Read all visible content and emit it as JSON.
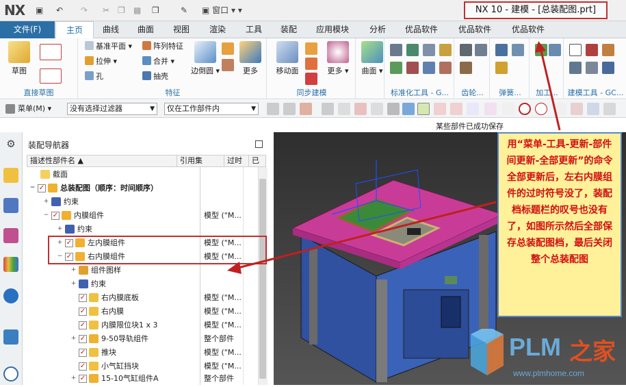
{
  "title_bar": {
    "logo": "NX",
    "window_title": "NX 10 - 建模 - [总装配图.prt]",
    "window_menu": "窗口"
  },
  "tabs": {
    "file": "文件(F)",
    "items": [
      "主页",
      "曲线",
      "曲面",
      "视图",
      "渲染",
      "工具",
      "装配",
      "应用模块",
      "分析",
      "优品软件",
      "优品软件",
      "优品软件"
    ],
    "active": "主页"
  },
  "ribbon": {
    "sketch_group": {
      "label": "直接草图",
      "big_label": "草图"
    },
    "feature_group": {
      "label": "特征",
      "items": [
        "基准平面",
        "拉伸",
        "孔",
        "阵列特征",
        "合并",
        "抽壳"
      ],
      "edge_blend": "边倒圆",
      "more": "更多"
    },
    "sync_group": {
      "label": "同步建模",
      "move_face": "移动面",
      "more": "更多"
    },
    "surface": {
      "label": "曲面"
    },
    "standard_tools": {
      "label": "标准化工具 - G..."
    },
    "gear": {
      "label": "齿轮..."
    },
    "spring": {
      "label": "弹簧..."
    },
    "machining": {
      "label": "加工..."
    },
    "modeling_tools": {
      "label": "建模工具 - GC..."
    }
  },
  "filter_bar": {
    "menu": "菜单(M)",
    "selection_filter": "没有选择过滤器",
    "scope": "仅在工作部件内"
  },
  "status": "某些部件已成功保存",
  "navigator": {
    "title": "装配导航器",
    "columns": [
      "描述性部件名",
      "引用集",
      "过时",
      "已"
    ],
    "rows": [
      {
        "label": "截面",
        "ref": ""
      },
      {
        "label": "总装配图（顺序：时间顺序）",
        "ref": ""
      },
      {
        "label": "约束",
        "ref": ""
      },
      {
        "label": "内膜组件",
        "ref": "模型 (\"M..."
      },
      {
        "label": "约束",
        "ref": ""
      },
      {
        "label": "左内膜组件",
        "ref": "模型 (\"M..."
      },
      {
        "label": "右内膜组件",
        "ref": "模型 (\"M..."
      },
      {
        "label": "组件图样",
        "ref": ""
      },
      {
        "label": "约束",
        "ref": ""
      },
      {
        "label": "右内膜底板",
        "ref": "模型 (\"M..."
      },
      {
        "label": "右内膜",
        "ref": "模型 (\"M..."
      },
      {
        "label": "内膜限位块1 x 3",
        "ref": "模型 (\"M..."
      },
      {
        "label": "9-50导轨组件",
        "ref": "整个部件"
      },
      {
        "label": "推块",
        "ref": "模型 (\"M..."
      },
      {
        "label": "小气缸挡块",
        "ref": "模型 (\"M..."
      },
      {
        "label": "15-10气缸组件A",
        "ref": "整个部件"
      }
    ]
  },
  "annotation": "用“菜单-工具-更新-部件间更新-全部更新”的命令全部更新后，左右内膜组件的过时符号没了，装配档标题栏的叹号也没有了，如图所示然后全部保存总装配图档，最后关闭整个总装配图",
  "watermark": {
    "brand": "PLM",
    "brand2": "之家",
    "url": "www.plmhome.com"
  },
  "colors": {
    "accent": "#2b6fa6",
    "highlight": "#c03030",
    "note_bg": "#fff19a",
    "note_text": "#d01010"
  }
}
